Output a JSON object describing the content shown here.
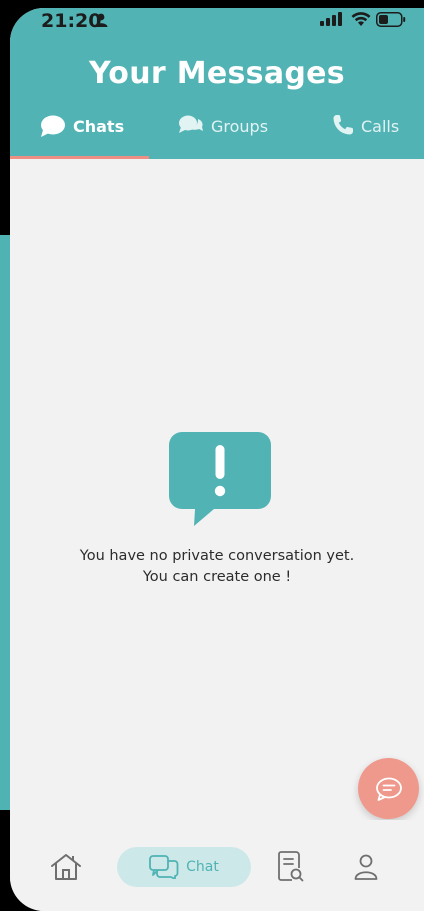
{
  "status_bar": {
    "time": "21:20"
  },
  "header": {
    "title": "Your Messages",
    "tabs": [
      {
        "label": "Chats",
        "icon": "chat-bubble-icon",
        "active": true
      },
      {
        "label": "Groups",
        "icon": "groups-bubble-icon",
        "active": false
      },
      {
        "label": "Calls",
        "icon": "phone-icon",
        "active": false
      }
    ]
  },
  "empty_state": {
    "icon": "alert-message-icon",
    "line1": "You have no private conversation yet.",
    "line2": "You can create one !"
  },
  "fab": {
    "icon": "new-chat-icon"
  },
  "bottom_nav": {
    "items": [
      {
        "icon": "home-icon"
      },
      {
        "icon": "chat-icon",
        "label": "Chat",
        "active": true
      },
      {
        "icon": "document-search-icon"
      },
      {
        "icon": "profile-icon"
      }
    ]
  },
  "colors": {
    "primary": "#52b3b5",
    "accent": "#ef998c",
    "tab_indicator": "#ee8f84",
    "background": "#f3f2f2"
  }
}
